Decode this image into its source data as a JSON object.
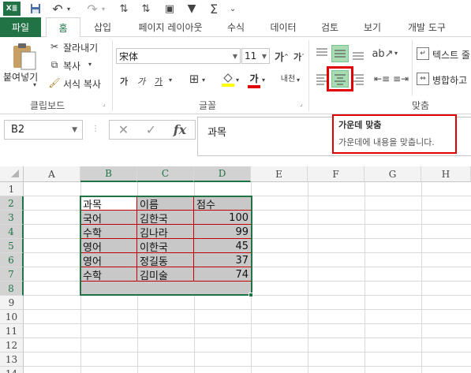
{
  "qat": {
    "icons": [
      "excel-logo-icon",
      "save-icon",
      "undo-icon",
      "redo-icon",
      "sort-asc-icon",
      "sort-desc-icon",
      "form-icon",
      "filter-icon",
      "autosum-icon",
      "qat-more-icon"
    ],
    "logo_text": "X≣",
    "save_glyph": "💾",
    "undo_glyph": "↶",
    "redo_glyph": "↷",
    "sort_asc_glyph": "⇅",
    "sort_desc_glyph": "⇅",
    "form_glyph": "▣",
    "filter_glyph": "▼",
    "sum_glyph": "Σ",
    "more_glyph": "⌄"
  },
  "tabs": [
    "파일",
    "홈",
    "삽입",
    "페이지 레이아웃",
    "수식",
    "데이터",
    "검토",
    "보기",
    "개발 도구"
  ],
  "ribbon": {
    "clipboard": {
      "paste_label": "붙여넣기",
      "cut_label": "잘라내기",
      "copy_label": "복사",
      "format_painter_label": "서식 복사",
      "group_label": "클립보드"
    },
    "font": {
      "font_name": "宋体",
      "font_size": "11",
      "grow_label": "가",
      "shrink_label": "가",
      "bold_label": "가",
      "italic_label": "가",
      "underline_label": "가",
      "phonetic_label": "내천",
      "group_label": "글꼴"
    },
    "alignment": {
      "wrap_text_label": "텍스트 줄",
      "merge_label": "병합하고",
      "group_label": "맞춤"
    }
  },
  "formula_bar": {
    "name_box": "B2",
    "content": "과목",
    "fx_label": "fx"
  },
  "tooltip": {
    "title": "가운데 맞춤",
    "description": "가운데에 내용을 맞춥니다."
  },
  "grid": {
    "columns": [
      "A",
      "B",
      "C",
      "D",
      "E",
      "F",
      "G",
      "H"
    ],
    "rows": [
      "1",
      "2",
      "3",
      "4",
      "5",
      "6",
      "7",
      "8",
      "9",
      "10",
      "11",
      "12",
      "13",
      "14"
    ],
    "table": [
      {
        "subject": "과목",
        "name": "이름",
        "score": "점수"
      },
      {
        "subject": "국어",
        "name": "김한국",
        "score": "100"
      },
      {
        "subject": "수학",
        "name": "김나라",
        "score": "99"
      },
      {
        "subject": "영어",
        "name": "이한국",
        "score": "45"
      },
      {
        "subject": "영어",
        "name": "정길동",
        "score": "37"
      },
      {
        "subject": "수학",
        "name": "김미술",
        "score": "74"
      }
    ]
  },
  "colors": {
    "accent": "#217346",
    "highlight_border": "#e00000",
    "table_border": "#c00000",
    "selection_fill": "#c8c8c8"
  }
}
